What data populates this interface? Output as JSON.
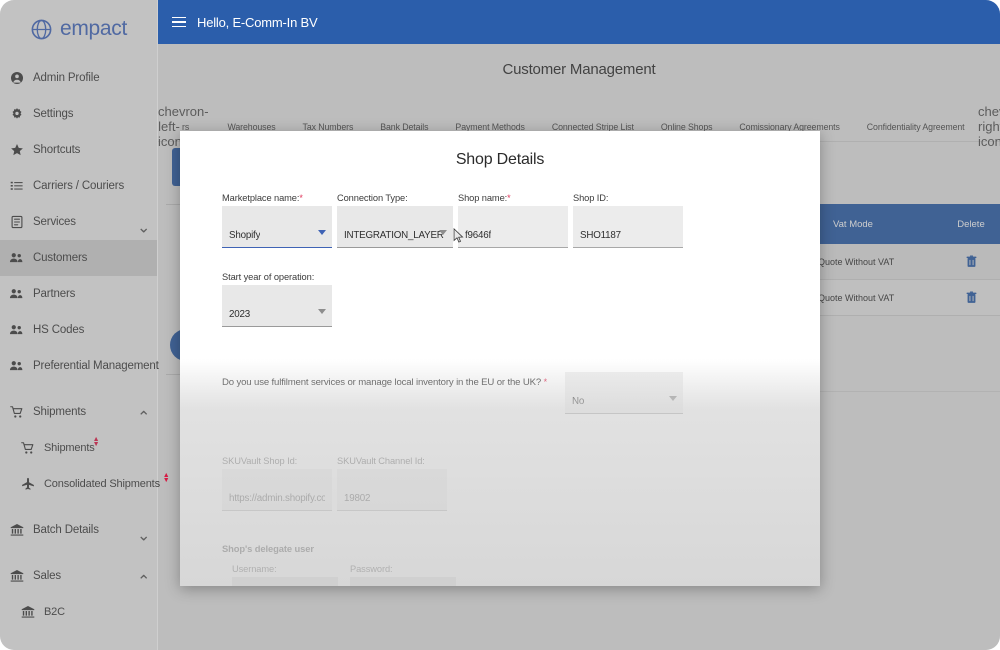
{
  "brand": {
    "name": "empact",
    "logo_icon": "globe-icon",
    "accent": "#2b5eab",
    "logo_color": "#3f63b5"
  },
  "sidebar": {
    "items": [
      {
        "label": "Admin Profile",
        "icon": "user-circle-icon",
        "active": false,
        "chevron": "",
        "level": 0,
        "mark": false
      },
      {
        "label": "Settings",
        "icon": "gear-icon",
        "active": false,
        "chevron": "",
        "level": 0,
        "mark": false
      },
      {
        "label": "Shortcuts",
        "icon": "star-icon",
        "active": false,
        "chevron": "",
        "level": 0,
        "mark": false
      },
      {
        "label": "Carriers / Couriers",
        "icon": "list-icon",
        "active": false,
        "chevron": "",
        "level": 0,
        "mark": false
      },
      {
        "label": "Services",
        "icon": "clipboard-icon",
        "active": false,
        "chevron": "⌄",
        "level": 0,
        "mark": false
      },
      {
        "label": "Customers",
        "icon": "people-icon",
        "active": true,
        "chevron": "",
        "level": 0,
        "mark": false
      },
      {
        "label": "Partners",
        "icon": "people-icon",
        "active": false,
        "chevron": "",
        "level": 0,
        "mark": false
      },
      {
        "label": "HS Codes",
        "icon": "people-icon",
        "active": false,
        "chevron": "",
        "level": 0,
        "mark": false
      },
      {
        "label": "Preferential Management",
        "icon": "people-icon",
        "active": false,
        "chevron": "",
        "level": 0,
        "mark": false
      },
      {
        "label": "Shipments",
        "icon": "cart-icon",
        "active": false,
        "chevron": "⌃",
        "level": 0,
        "mark": false
      },
      {
        "label": "Shipments",
        "icon": "cart-icon",
        "active": false,
        "chevron": "",
        "level": 1,
        "mark": true
      },
      {
        "label": "Consolidated Shipments",
        "icon": "plane-icon",
        "active": false,
        "chevron": "",
        "level": 1,
        "mark": true
      },
      {
        "label": "Batch Details",
        "icon": "bank-icon",
        "active": false,
        "chevron": "⌄",
        "level": 0,
        "mark": false
      },
      {
        "label": "Sales",
        "icon": "bank-icon",
        "active": false,
        "chevron": "⌃",
        "level": 0,
        "mark": false
      },
      {
        "label": "B2C",
        "icon": "bank-icon",
        "active": false,
        "chevron": "",
        "level": 1,
        "mark": false
      }
    ]
  },
  "topbar": {
    "greeting": "Hello, E-Comm-In BV",
    "menu_icon": "hamburger-icon"
  },
  "page": {
    "title": "Customer Management"
  },
  "tabstrip": {
    "prev_icon": "chevron-left-icon",
    "next_icon": "chevron-right-icon",
    "tabs": [
      {
        "label": "rs",
        "clipped": true
      },
      {
        "label": "Warehouses",
        "clipped": false
      },
      {
        "label": "Tax Numbers",
        "clipped": false
      },
      {
        "label": "Bank Details",
        "clipped": false
      },
      {
        "label": "Payment Methods",
        "clipped": false
      },
      {
        "label": "Connected Stripe List",
        "clipped": false
      },
      {
        "label": "Online Shops",
        "clipped": false
      },
      {
        "label": "Comissionary Agreements",
        "clipped": false
      },
      {
        "label": "Confidentiality Agreement",
        "clipped": false
      }
    ]
  },
  "background_table": {
    "columns": [
      "Vat Mode",
      "Delete"
    ],
    "rows": [
      {
        "vat_mode": "Quote Without VAT",
        "delete_icon": "trash-icon"
      },
      {
        "vat_mode": "Quote Without VAT",
        "delete_icon": "trash-icon"
      }
    ]
  },
  "modal": {
    "title": "Shop Details",
    "fields": {
      "marketplace_name": {
        "label": "Marketplace name:",
        "required": true,
        "value": "Shopify",
        "type": "select",
        "focused": true
      },
      "connection_type": {
        "label": "Connection Type:",
        "required": false,
        "value": "INTEGRATION_LAYER",
        "type": "select",
        "focused": false
      },
      "shop_name": {
        "label": "Shop name:",
        "required": true,
        "value": "f9646f",
        "type": "text",
        "focused": false
      },
      "shop_id": {
        "label": "Shop ID:",
        "required": false,
        "value": "SHO1187",
        "type": "text",
        "focused": false
      },
      "start_year": {
        "label": "Start year of operation:",
        "required": false,
        "value": "2023",
        "type": "select",
        "focused": false
      },
      "fulfilment_question": {
        "label": "Do you use fulfilment services or manage local inventory in the EU or the UK?",
        "required": true,
        "value": "No",
        "type": "select",
        "focused": false
      },
      "skuvault_shop_id": {
        "label": "SKUVault Shop Id:",
        "required": false,
        "value": "https://admin.shopify.com/st",
        "type": "text",
        "focused": false
      },
      "skuvault_channel_id": {
        "label": "SKUVault Channel Id:",
        "required": false,
        "value": "19802",
        "type": "text",
        "focused": false
      },
      "delegate_section": {
        "label": "Shop's delegate user"
      },
      "username": {
        "label": "Username:",
        "required": false,
        "value": "",
        "type": "text",
        "focused": false
      },
      "password": {
        "label": "Password:",
        "required": false,
        "value": "",
        "type": "password",
        "focused": false
      }
    }
  }
}
